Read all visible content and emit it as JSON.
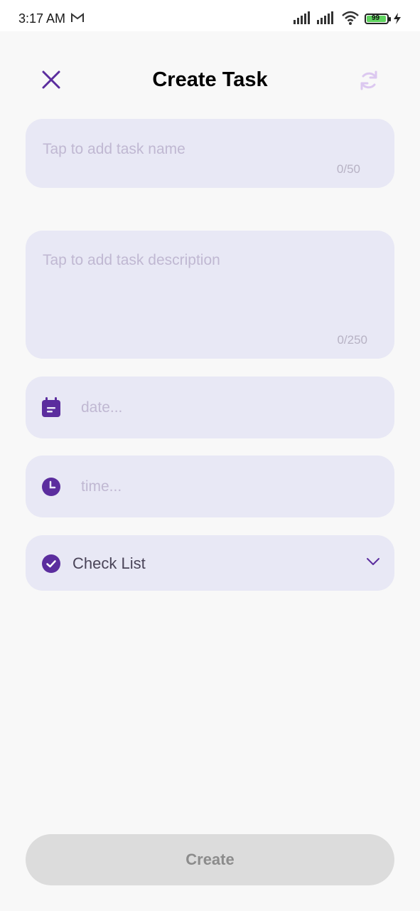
{
  "status_bar": {
    "time": "3:17 AM",
    "battery_level": "99"
  },
  "header": {
    "title": "Create Task"
  },
  "task_name": {
    "placeholder": "Tap to add task name",
    "counter": "0/50"
  },
  "task_description": {
    "placeholder": "Tap to add task description",
    "counter": "0/250"
  },
  "date": {
    "placeholder": "date..."
  },
  "time": {
    "placeholder": "time..."
  },
  "checklist": {
    "label": "Check List"
  },
  "create_button": {
    "label": "Create"
  },
  "colors": {
    "accent": "#5b2d9e",
    "field_bg": "#e8e8f5",
    "disabled_button": "#dcdcdc"
  },
  "icons": {
    "close": "close-icon",
    "refresh": "refresh-icon",
    "date": "calendar-icon",
    "time": "clock-icon",
    "checklist": "check-circle-icon",
    "expand": "chevron-down-icon"
  }
}
